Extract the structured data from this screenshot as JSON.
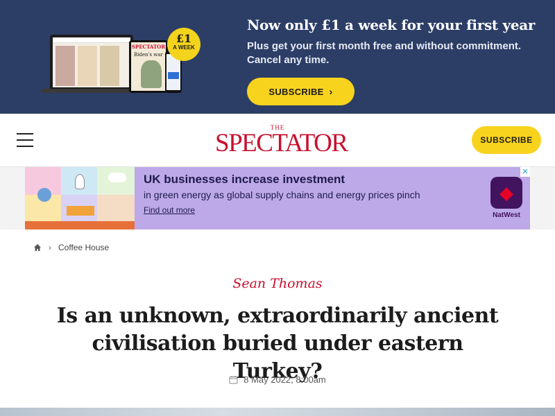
{
  "promo": {
    "heading": "Now only £1 a week for your first year",
    "subtext": "Plus get your first month free and without commitment. Cancel any time.",
    "button_label": "SUBSCRIBE",
    "button_icon": "chevron-right-icon",
    "badge_price": "£1",
    "badge_period": "A WEEK",
    "tablet_masthead": "SPECTATOR",
    "tablet_cover_title": "Biden's war"
  },
  "header": {
    "logo_the": "THE",
    "logo_name": "SPECTATOR",
    "subscribe_label": "SUBSCRIBE",
    "menu_icon": "hamburger-menu-icon"
  },
  "ad": {
    "headline": "UK businesses increase investment",
    "body": "in green energy as global supply chains and energy prices pinch",
    "link": "Find out more",
    "brand": "NatWest",
    "close_icon": "close-icon"
  },
  "breadcrumb": {
    "home_icon": "home-icon",
    "section": "Coffee House"
  },
  "article": {
    "author": "Sean Thomas",
    "title": "Is an unknown, extraordinarily ancient civilisation buried under eastern Turkey?",
    "date": "8 May 2022, 8:00am",
    "date_icon": "calendar-icon"
  },
  "colors": {
    "promo_bg": "#2c3e66",
    "accent_yellow": "#f8d31e",
    "brand_red": "#c8102e",
    "ad_bg": "#bda9e8",
    "natwest_purple": "#42145f"
  }
}
